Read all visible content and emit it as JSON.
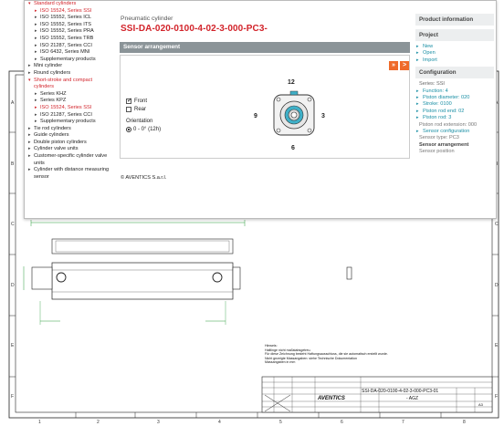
{
  "tree": {
    "items": [
      {
        "label": "Standard cylinders",
        "level": 1,
        "red": true,
        "arrow": "▾"
      },
      {
        "label": "ISO 15524, Series SSI",
        "level": 2,
        "red": true,
        "arrow": "▸"
      },
      {
        "label": "ISO 15552, Series ICL",
        "level": 2,
        "arrow": "▸"
      },
      {
        "label": "ISO 15552, Series ITS",
        "level": 2,
        "arrow": "▸"
      },
      {
        "label": "ISO 15552, Series PRA",
        "level": 2,
        "arrow": "▸"
      },
      {
        "label": "ISO 15552, Series TRB",
        "level": 2,
        "arrow": "▸"
      },
      {
        "label": "ISO 21287, Series CCI",
        "level": 2,
        "arrow": "▸"
      },
      {
        "label": "ISO 6432, Series MNI",
        "level": 2,
        "arrow": "▸"
      },
      {
        "label": "Supplementary products",
        "level": 2,
        "arrow": "▸"
      },
      {
        "label": "Mini cylinder",
        "level": 1,
        "arrow": "▸"
      },
      {
        "label": "Round cylinders",
        "level": 1,
        "arrow": "▸"
      },
      {
        "label": "Short-stroke and compact cylinders",
        "level": 1,
        "red": true,
        "arrow": "▾",
        "wrap": true
      },
      {
        "label": "Series KHZ",
        "level": 2,
        "arrow": "▸"
      },
      {
        "label": "Series KPZ",
        "level": 2,
        "arrow": "▸"
      },
      {
        "label": "ISO 15524, Series SSI",
        "level": 2,
        "red": true,
        "arrow": "▸"
      },
      {
        "label": "ISO 21287, Series CCI",
        "level": 2,
        "arrow": "▸"
      },
      {
        "label": "Supplementary products",
        "level": 2,
        "arrow": "▸"
      },
      {
        "label": "Tie rod cylinders",
        "level": 1,
        "arrow": "▸"
      },
      {
        "label": "Guide cylinders",
        "level": 1,
        "arrow": "▸"
      },
      {
        "label": "Double piston cylinders",
        "level": 1,
        "arrow": "▸"
      },
      {
        "label": "Cylinder valve units",
        "level": 1,
        "arrow": "▸"
      },
      {
        "label": "Customer-specific cylinder valve units",
        "level": 1,
        "arrow": "▸",
        "wrap": true
      },
      {
        "label": "Cylinder with distance measuring sensor",
        "level": 1,
        "arrow": "▸",
        "wrap": true
      }
    ]
  },
  "center": {
    "crumb": "Pneumatic cylinder",
    "code": "SSI-DA-020-0100-4-02-3-000-PC3-",
    "section_title": "Sensor arrangement",
    "nav_prev": "»",
    "nav_next": ">",
    "options": {
      "front_label": "Front",
      "front_checked": true,
      "rear_label": "Rear",
      "rear_checked": false,
      "orientation_label": "Orientation",
      "orientation_value": "0 - 0° (12h)"
    },
    "diagram": {
      "top": "12",
      "right": "3",
      "bottom": "6",
      "left": "9"
    },
    "copyright": "© AVENTICS S.a.r.l."
  },
  "right": {
    "product_info": "Product information",
    "project": "Project",
    "project_links": [
      "New",
      "Open",
      "Import"
    ],
    "configuration": "Configuration",
    "series": "Series: SSI",
    "config_links": [
      "Function: 4",
      "Piston diameter: 020",
      "Stroke: 0100",
      "Piston rod end: 02",
      "Piston rod: 3"
    ],
    "rod_extension": "Piston rod extension: 000",
    "sensor_config": "Sensor configuration",
    "sensor_type": "Sensor type: PC3",
    "sensor_arrangement": "Sensor arrangement",
    "sensor_position": "Sensor position"
  },
  "drawing": {
    "row_labels": [
      "A",
      "B",
      "C",
      "D",
      "E",
      "F"
    ],
    "col_labels": [
      "1",
      "2",
      "3",
      "4",
      "5",
      "6",
      "7",
      "8"
    ],
    "notes": [
      "Hinweis:",
      "Haltlinge nicht maßstabsgetreu.",
      "Für diese Zeichnung besteht Haftungsausschluss, die sie automatisch erstellt wurde.",
      "Nicht gezeigte Massangaben: siehe Technische Dokumentation",
      "Massangaben in mm"
    ],
    "title_code": "SSI-DA-020-0100-4-02-3-000-PC3-01",
    "brand": "AVENTICS",
    "agz": "- AGZ",
    "sheet_size": "A3"
  }
}
